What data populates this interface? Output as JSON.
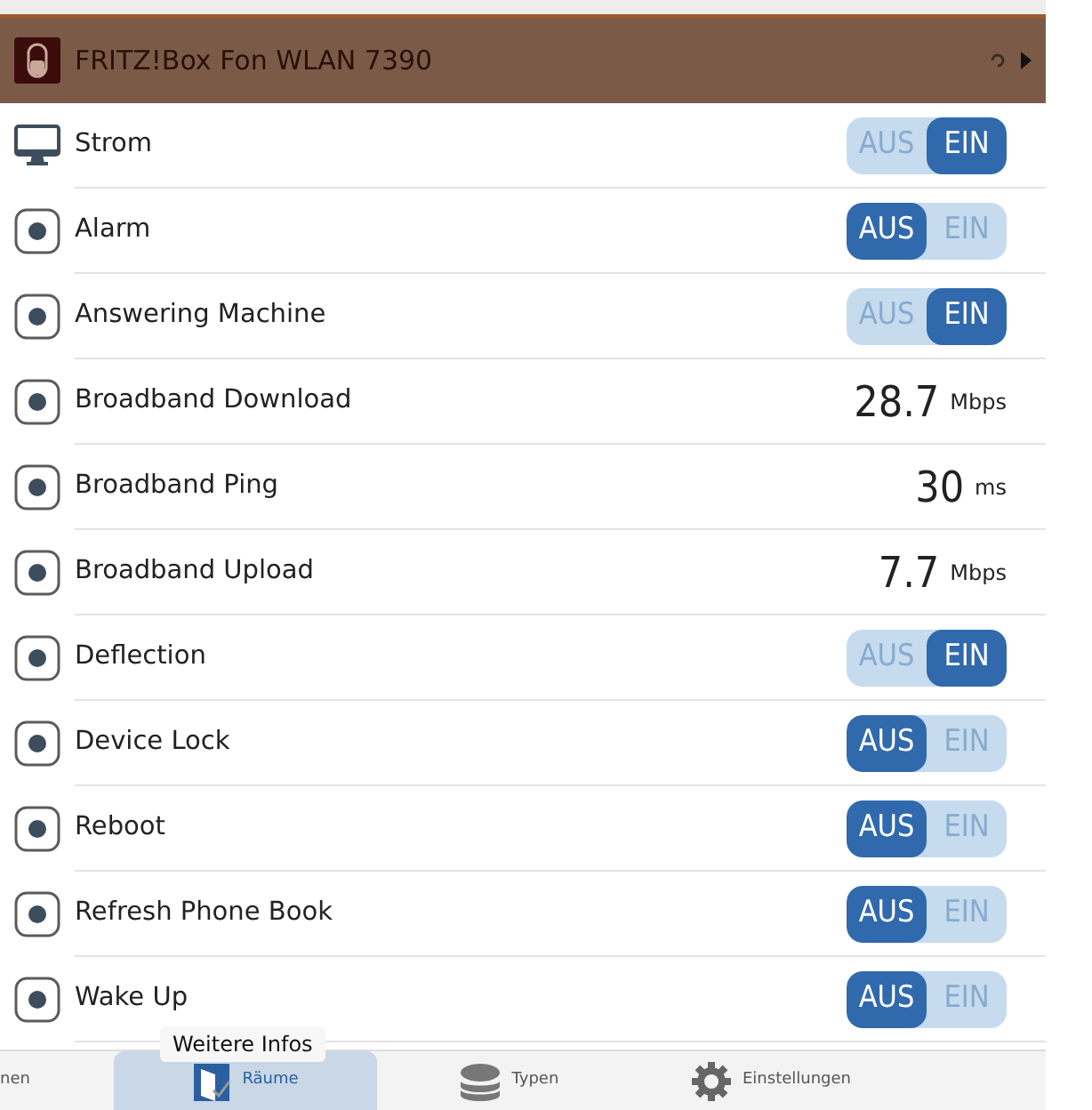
{
  "header": {
    "title": "FRITZ!Box Fon WLAN 7390"
  },
  "rows": [
    {
      "kind": "toggle",
      "label": "Strom",
      "off_label": "AUS",
      "on_label": "EIN",
      "on": true
    },
    {
      "kind": "toggle",
      "label": "Alarm",
      "off_label": "AUS",
      "on_label": "EIN",
      "on": false
    },
    {
      "kind": "toggle",
      "label": "Answering Machine",
      "off_label": "AUS",
      "on_label": "EIN",
      "on": true
    },
    {
      "kind": "value",
      "label": "Broadband Download",
      "value": "28.7",
      "unit": "Mbps"
    },
    {
      "kind": "value",
      "label": "Broadband Ping",
      "value": "30",
      "unit": "ms"
    },
    {
      "kind": "value",
      "label": "Broadband Upload",
      "value": "7.7",
      "unit": "Mbps"
    },
    {
      "kind": "toggle",
      "label": "Deflection",
      "off_label": "AUS",
      "on_label": "EIN",
      "on": true
    },
    {
      "kind": "toggle",
      "label": "Device Lock",
      "off_label": "AUS",
      "on_label": "EIN",
      "on": false
    },
    {
      "kind": "toggle",
      "label": "Reboot",
      "off_label": "AUS",
      "on_label": "EIN",
      "on": false
    },
    {
      "kind": "toggle",
      "label": "Refresh Phone Book",
      "off_label": "AUS",
      "on_label": "EIN",
      "on": false
    },
    {
      "kind": "toggle",
      "label": "Wake Up",
      "off_label": "AUS",
      "on_label": "EIN",
      "on": false
    }
  ],
  "tooltip": "Weitere Infos",
  "tabs": [
    {
      "label": "nen",
      "selected": false
    },
    {
      "label": "Räume",
      "selected": true
    },
    {
      "label": "Typen",
      "selected": false
    },
    {
      "label": "Einstellungen",
      "selected": false
    }
  ]
}
